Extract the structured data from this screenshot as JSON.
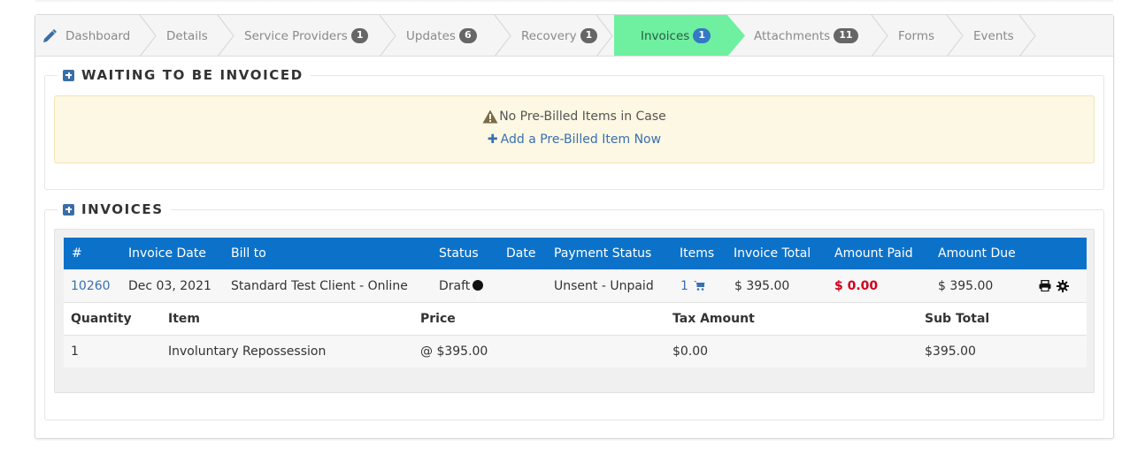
{
  "steps": [
    {
      "label": "Dashboard",
      "badge": null
    },
    {
      "label": "Details",
      "badge": null
    },
    {
      "label": "Service Providers",
      "badge": "1"
    },
    {
      "label": "Updates",
      "badge": "6"
    },
    {
      "label": "Recovery",
      "badge": "1"
    },
    {
      "label": "Invoices",
      "badge": "1",
      "active": true
    },
    {
      "label": "Attachments",
      "badge": "11"
    },
    {
      "label": "Forms",
      "badge": null
    },
    {
      "label": "Events",
      "badge": null
    }
  ],
  "waiting": {
    "title": "WAITING TO BE INVOICED",
    "empty_message": "No Pre-Billed Items in Case",
    "add_link": "Add a Pre-Billed Item Now"
  },
  "invoices": {
    "title": "INVOICES",
    "columns": [
      "#",
      "Invoice Date",
      "Bill to",
      "Status",
      "Date",
      "Payment Status",
      "Items",
      "Invoice Total",
      "Amount Paid",
      "Amount Due"
    ],
    "row": {
      "number": "10260",
      "invoice_date": "Dec 03, 2021",
      "bill_to": "Standard Test Client - Online",
      "status": "Draft",
      "date": "",
      "payment_status": "Unsent - Unpaid",
      "items": "1",
      "invoice_total": "$ 395.00",
      "amount_paid": "$ 0.00",
      "amount_due": "$ 395.00"
    },
    "line_columns": [
      "Quantity",
      "Item",
      "Price",
      "Tax Amount",
      "Sub Total"
    ],
    "line_items": [
      {
        "quantity": "1",
        "item": "Involuntary Repossession",
        "price": "@ $395.00",
        "tax": "$0.00",
        "subtotal": "$395.00"
      }
    ]
  },
  "colors": {
    "active_step": "#6ef0a0",
    "table_header": "#0c72c9",
    "alert_bg": "#fcf8e3",
    "amount_paid": "#d0021b"
  }
}
